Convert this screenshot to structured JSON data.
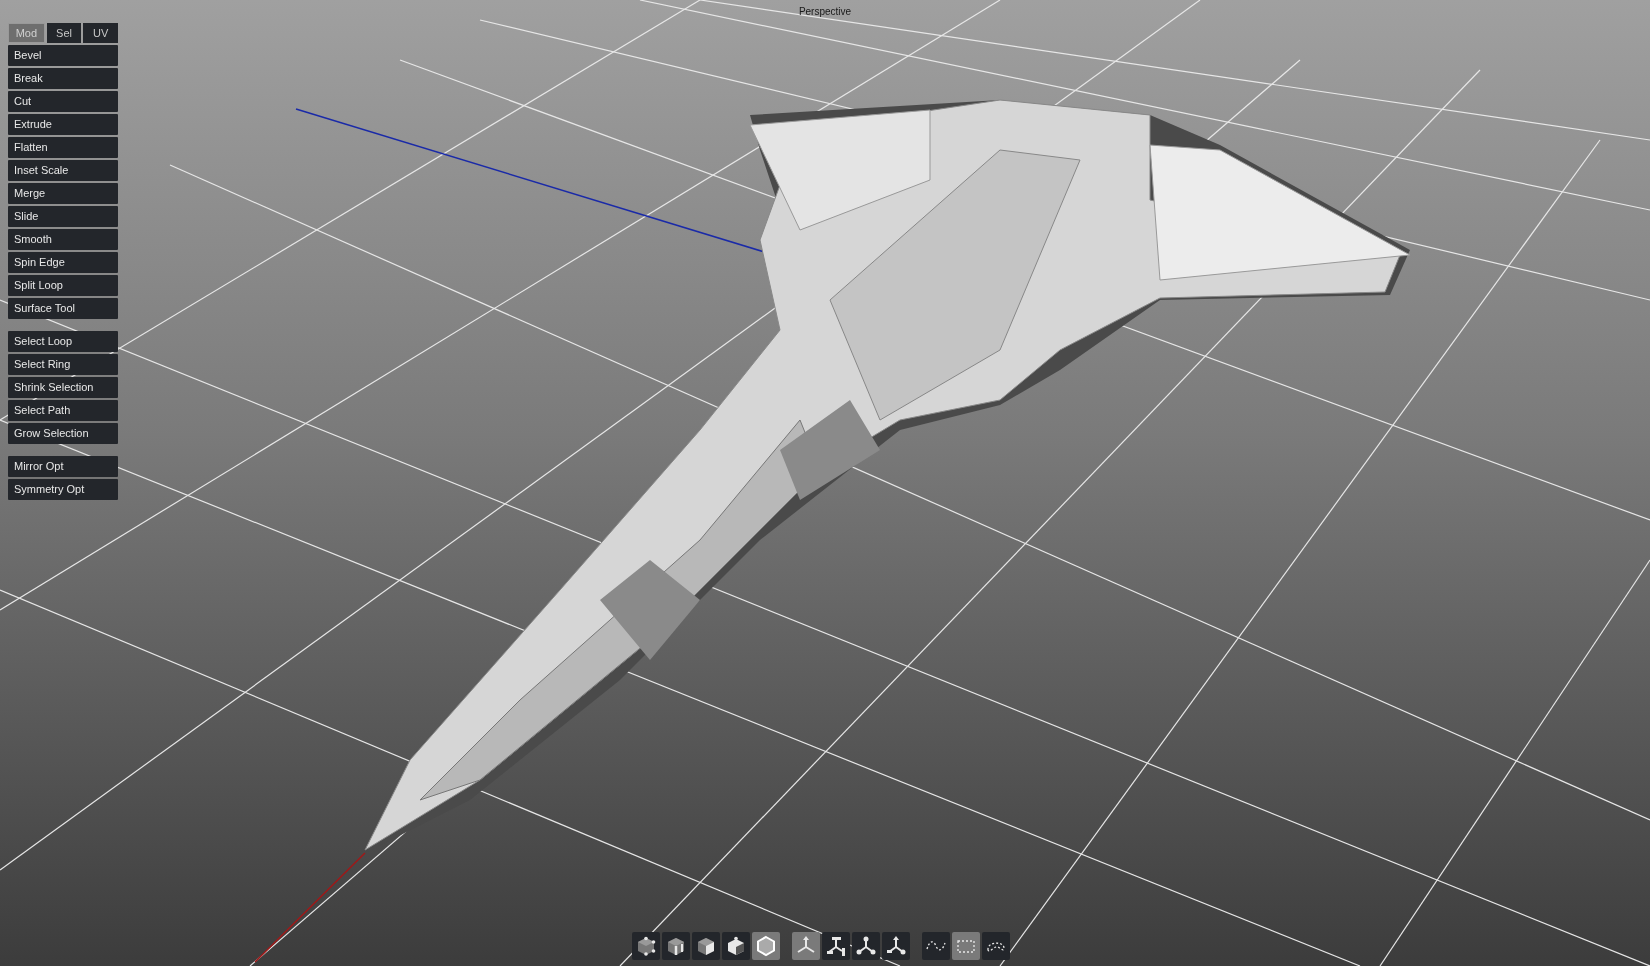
{
  "viewport": {
    "title": "Perspective"
  },
  "tabs": [
    {
      "label": "Mod",
      "selected": true
    },
    {
      "label": "Sel",
      "selected": false
    },
    {
      "label": "UV",
      "selected": false
    }
  ],
  "tool_groups": [
    [
      "Bevel",
      "Break",
      "Cut",
      "Extrude",
      "Flatten",
      "Inset Scale",
      "Merge",
      "Slide",
      "Smooth",
      "Spin Edge",
      "Split Loop",
      "Surface Tool"
    ],
    [
      "Select Loop",
      "Select Ring",
      "Shrink Selection",
      "Select Path",
      "Grow Selection"
    ],
    [
      "Mirror Opt",
      "Symmetry Opt"
    ]
  ],
  "toolbar_groups": [
    [
      {
        "kind": "vertex",
        "selected": false
      },
      {
        "kind": "edge",
        "selected": false
      },
      {
        "kind": "face",
        "selected": false
      },
      {
        "kind": "element",
        "selected": false
      },
      {
        "kind": "object",
        "selected": true
      }
    ],
    [
      {
        "kind": "move",
        "selected": true
      },
      {
        "kind": "rotate",
        "selected": false
      },
      {
        "kind": "scale",
        "selected": false
      },
      {
        "kind": "universal",
        "selected": false
      }
    ],
    [
      {
        "kind": "lasso",
        "selected": false
      },
      {
        "kind": "rect",
        "selected": true
      },
      {
        "kind": "paint",
        "selected": false
      }
    ]
  ]
}
